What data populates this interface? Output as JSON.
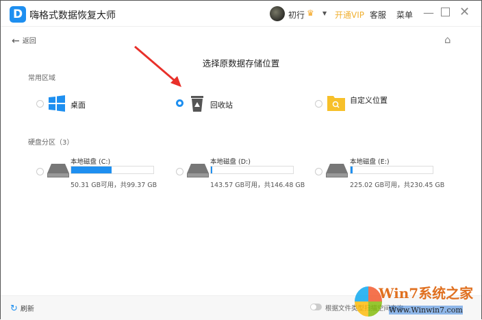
{
  "app": {
    "title": "嗨格式数据恢复大师",
    "logo_letter": "D"
  },
  "header": {
    "user_name": "初行",
    "vip_label": "开通VIP",
    "service_label": "客服",
    "menu_label": "菜单"
  },
  "nav": {
    "back_label": "返回"
  },
  "page_title": "选择原数据存储位置",
  "common": {
    "heading": "常用区域",
    "options": [
      {
        "label": "桌面",
        "selected": false,
        "icon": "windows-icon"
      },
      {
        "label": "回收站",
        "selected": true,
        "icon": "recycle-bin-icon"
      },
      {
        "label": "自定义位置",
        "selected": false,
        "icon": "folder-search-icon"
      }
    ]
  },
  "disks": {
    "heading": "硬盘分区（3）",
    "items": [
      {
        "name": "本地磁盘 (C:)",
        "info": "50.31 GB可用，共99.37 GB",
        "used_fraction": 0.494
      },
      {
        "name": "本地磁盘 (D:)",
        "info": "143.57 GB可用，共146.48 GB",
        "used_fraction": 0.02
      },
      {
        "name": "本地磁盘 (E:)",
        "info": "225.02 GB可用，共230.45 GB",
        "used_fraction": 0.024
      }
    ]
  },
  "footer": {
    "refresh_label": "刷新",
    "toggle_label": "根据文件类型扫描空间查询",
    "toggle_on": false
  },
  "watermark": {
    "line1": "Win7系统之家",
    "line2": "Www.Winwin7.com"
  },
  "colors": {
    "accent": "#1e8ff0",
    "vip": "#f0b030",
    "arrow": "#e8302a"
  }
}
